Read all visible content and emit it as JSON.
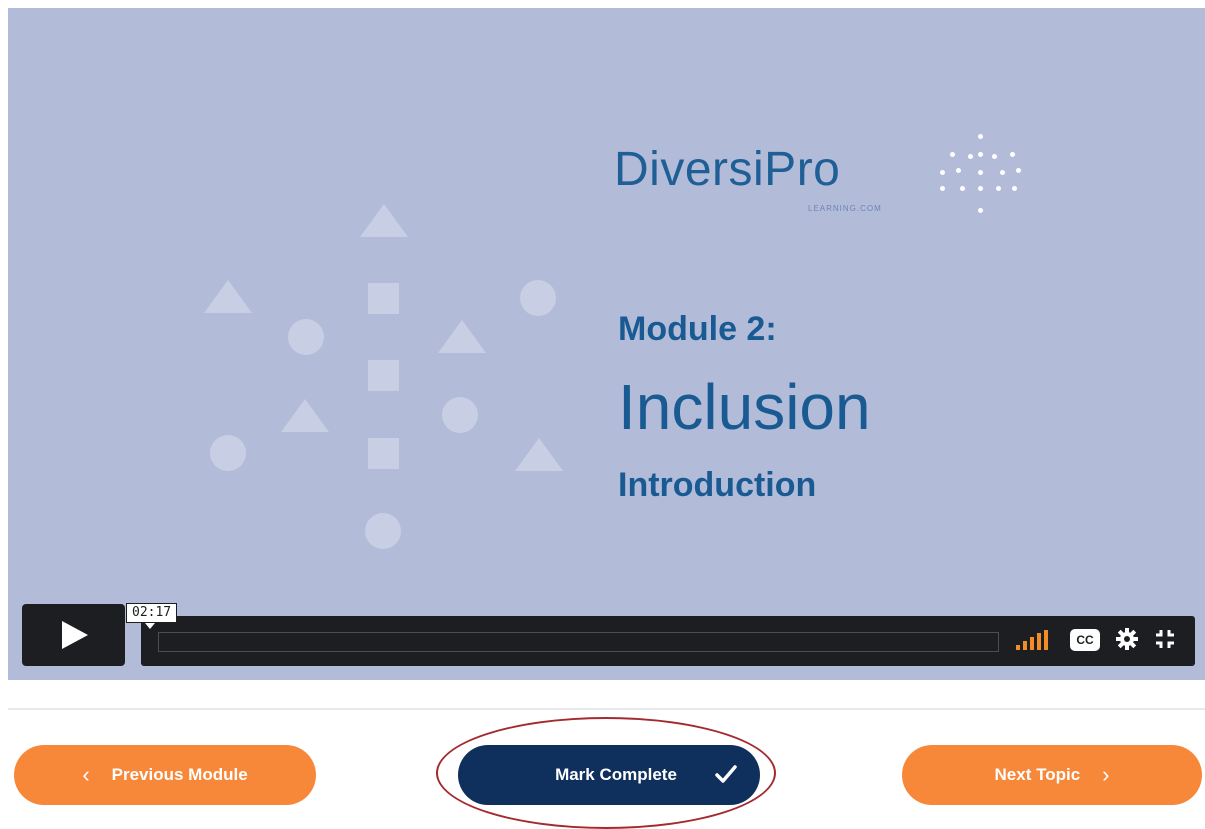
{
  "video": {
    "brand_name": "DiversiPro",
    "brand_sub": "LEARNING.COM",
    "module_label": "Module 2:",
    "module_title": "Inclusion",
    "module_subtitle": "Introduction",
    "background_color": "#b2bcd9",
    "text_color": "#1a5a92"
  },
  "player": {
    "timecode": "02:17",
    "play_icon": "play-icon",
    "volume_icon": "volume-icon",
    "cc_label": "CC",
    "settings_icon": "gear-icon",
    "fullscreen_icon": "fullscreen-icon",
    "accent_color": "#f28c28"
  },
  "navigation": {
    "previous_label": "Previous Module",
    "mark_complete_label": "Mark Complete",
    "next_label": "Next Topic",
    "orange": "#f7883a",
    "navy": "#0f2f5c"
  }
}
